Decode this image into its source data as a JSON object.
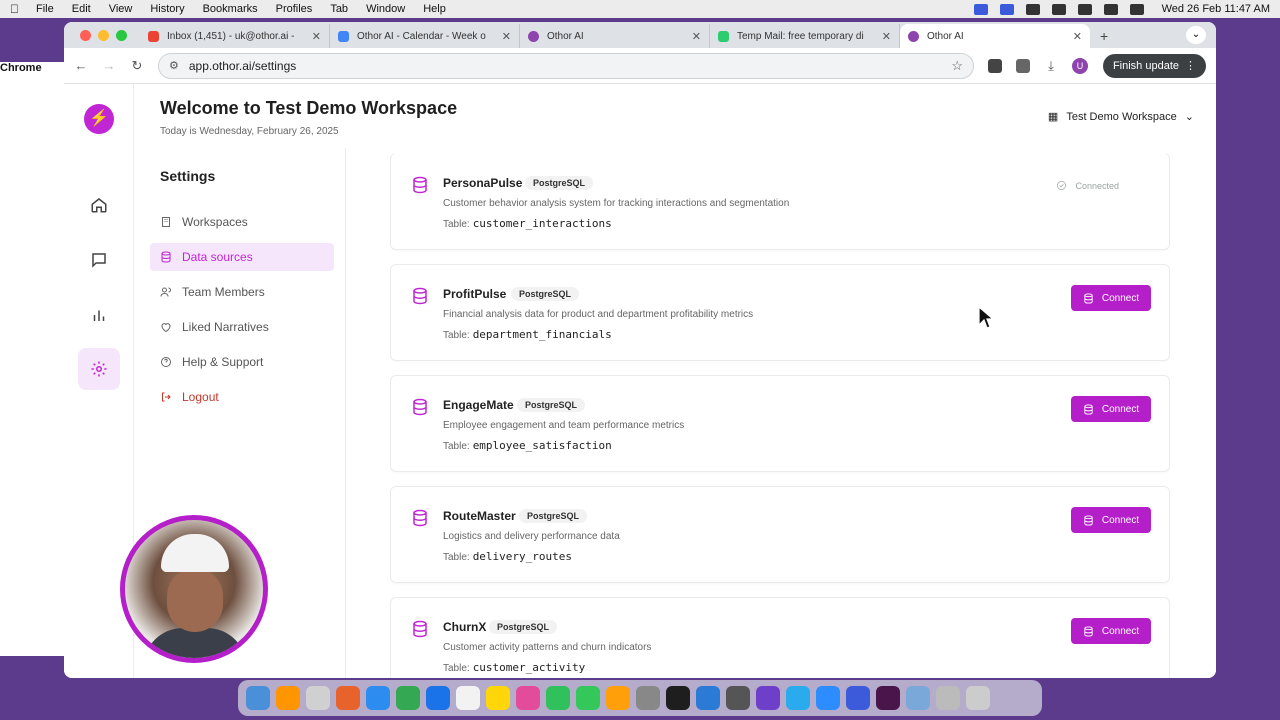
{
  "menubar": {
    "items": [
      "Chrome",
      "File",
      "Edit",
      "View",
      "History",
      "Bookmarks",
      "Profiles",
      "Tab",
      "Window",
      "Help"
    ],
    "clock": "Wed 26 Feb  11:47 AM"
  },
  "tabs": [
    {
      "title": "Inbox (1,451) - uk@othor.ai -",
      "color": "#ea4335"
    },
    {
      "title": "Othor AI - Calendar - Week o",
      "color": "#4285f4"
    },
    {
      "title": "Othor AI",
      "color": "#8e44ad"
    },
    {
      "title": "Temp Mail: free temporary di",
      "color": "#2ecc71"
    },
    {
      "title": "Othor AI",
      "color": "#8e44ad"
    }
  ],
  "browser": {
    "url": "app.othor.ai/settings",
    "finish_update": "Finish update",
    "profile_initial": "U"
  },
  "header": {
    "title": "Welcome to Test Demo Workspace",
    "subtitle": "Today is Wednesday, February 26, 2025",
    "workspace": "Test Demo Workspace"
  },
  "settings": {
    "title": "Settings",
    "items": [
      {
        "label": "Workspaces"
      },
      {
        "label": "Data sources"
      },
      {
        "label": "Team Members"
      },
      {
        "label": "Liked Narratives"
      },
      {
        "label": "Help & Support"
      },
      {
        "label": "Logout"
      }
    ]
  },
  "datasources": [
    {
      "name": "PersonaPulse",
      "badge": "PostgreSQL",
      "description": "Customer behavior analysis system for tracking interactions and segmentation",
      "table_label": "Table:",
      "table": "customer_interactions",
      "status": "Connected"
    },
    {
      "name": "ProfitPulse",
      "badge": "PostgreSQL",
      "description": "Financial analysis data for product and department profitability metrics",
      "table_label": "Table:",
      "table": "department_financials",
      "action": "Connect"
    },
    {
      "name": "EngageMate",
      "badge": "PostgreSQL",
      "description": "Employee engagement and team performance metrics",
      "table_label": "Table:",
      "table": "employee_satisfaction",
      "action": "Connect"
    },
    {
      "name": "RouteMaster",
      "badge": "PostgreSQL",
      "description": "Logistics and delivery performance data",
      "table_label": "Table:",
      "table": "delivery_routes",
      "action": "Connect"
    },
    {
      "name": "ChurnX",
      "badge": "PostgreSQL",
      "description": "Customer activity patterns and churn indicators",
      "table_label": "Table:",
      "table": "customer_activity",
      "action": "Connect"
    }
  ],
  "colors": {
    "accent": "#b51fc9",
    "accent_soft": "#f6e6fb"
  }
}
